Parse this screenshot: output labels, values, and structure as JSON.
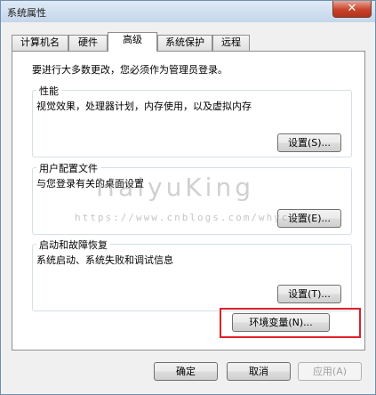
{
  "window": {
    "title": "系统属性",
    "close_glyph": "✕"
  },
  "tabs": [
    {
      "label": "计算机名",
      "active": false
    },
    {
      "label": "硬件",
      "active": false
    },
    {
      "label": "高级",
      "active": true
    },
    {
      "label": "系统保护",
      "active": false
    },
    {
      "label": "远程",
      "active": false
    }
  ],
  "notice": "要进行大多数更改，您必须作为管理员登录。",
  "groups": {
    "performance": {
      "title": "性能",
      "desc": "视觉效果，处理器计划，内存使用，以及虚拟内存",
      "button": "设置(S)..."
    },
    "user_profiles": {
      "title": "用户配置文件",
      "desc": "与您登录有关的桌面设置",
      "button": "设置(E)..."
    },
    "startup_recovery": {
      "title": "启动和故障恢复",
      "desc": "系统启动、系统失败和调试信息",
      "button": "设置(T)..."
    }
  },
  "env_button": "环境变量(N)...",
  "footer": {
    "ok": "确定",
    "cancel": "取消",
    "apply": "应用(A)"
  },
  "watermark": {
    "text": "HaiyuKing",
    "url": "https://www.cnblogs.com/whycxb/"
  },
  "colors": {
    "highlight": "#e0202a",
    "close_button": "#c7432c"
  }
}
